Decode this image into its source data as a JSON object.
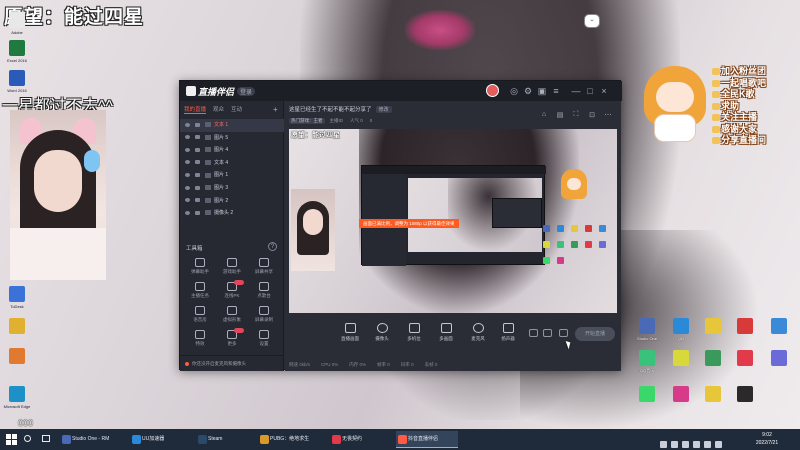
{
  "overlay": {
    "wish": "愿望：能过四星",
    "no_star": "一星都过不去^^",
    "volume_number": "000"
  },
  "desktop": {
    "left_icons": [
      {
        "label": "Adobe",
        "color": "#e8e8e8"
      },
      {
        "label": "Excel 2016",
        "color": "#1f7a3f"
      },
      {
        "label": "Word 2016",
        "color": "#2b5bb8"
      },
      {
        "label": "ToDesk",
        "color": "#3a72d8"
      },
      {
        "label": "",
        "color": "#e0b030"
      },
      {
        "label": "",
        "color": "#e07a30"
      },
      {
        "label": "Microsoft Edge",
        "color": "#1e90c8"
      }
    ],
    "right_icons": [
      {
        "label": "Studio One",
        "color": "#4a6ab8"
      },
      {
        "label": "QQ",
        "color": "#2a8ad8"
      },
      {
        "label": "",
        "color": "#e8c63a"
      },
      {
        "label": "",
        "color": "#d83a3a"
      },
      {
        "label": "",
        "color": "#3a8ad8"
      },
      {
        "label": "",
        "color": "#d8d83a"
      },
      {
        "label": "QQ音乐",
        "color": "#38c27a"
      },
      {
        "label": "",
        "color": "#3a9a5a"
      },
      {
        "label": "",
        "color": "#e23a4a"
      },
      {
        "label": "",
        "color": "#6a6ad8"
      },
      {
        "label": "",
        "color": "#3ad86a"
      },
      {
        "label": "",
        "color": "#d83a8a"
      },
      {
        "label": "",
        "color": "#e8c63a"
      },
      {
        "label": "",
        "color": "#2a2a2a"
      }
    ]
  },
  "commands": [
    "加入粉丝团",
    "一起唱歌吧",
    "全民K歌",
    "求助",
    "关注主播",
    "感谢大家",
    "分享直播间"
  ],
  "app": {
    "name": "直播伴侣",
    "badge": "登录",
    "window_buttons": [
      "—",
      "□",
      "×"
    ],
    "tabs": [
      "我的直播",
      "观众",
      "互动"
    ],
    "layers": [
      "文本 1",
      "图片 5",
      "图片 4",
      "文本 4",
      "图片 1",
      "图片 3",
      "图片 2",
      "摄像头 2"
    ],
    "tools_title": "工具箱",
    "tools": [
      "弹幕助手",
      "游戏助手",
      "屏幕共享",
      "主播任务",
      "连线PK",
      "点歌台",
      "语音房",
      "虚拟形象",
      "屏幕录制",
      "特效",
      "更多",
      "设置"
    ],
    "footer_tip": "你还没开启麦克风和摄像头",
    "stream_title": "这星已经生了不起不能不起分享了",
    "edit_label": "修改",
    "stream_meta": {
      "category": "热门游戏：王者",
      "items": [
        "主播ID",
        "人气 0",
        "0"
      ]
    },
    "preview": {
      "wish_small": "愿望：能过四星",
      "toast": "画面已满比例，调整为 1080p 以获得最佳效果"
    },
    "controls": [
      "直播画面",
      "摄像头",
      "多机位",
      "多画面",
      "麦克风",
      "扬声器"
    ],
    "go_live": "开始直播",
    "status": [
      "网速 0kb/s",
      "CPU 0%",
      "内存 0%",
      "帧率 0",
      "码率 0",
      "丢帧 0"
    ]
  },
  "taskbar": {
    "tasks": [
      {
        "label": "Studio One - RM",
        "color": "#4a6ab8",
        "active": false
      },
      {
        "label": "UU加速器",
        "color": "#2a8ad8",
        "active": false
      },
      {
        "label": "Steam",
        "color": "#2a4a6a",
        "active": false
      },
      {
        "label": "PUBG：绝地求生",
        "color": "#d89a2a",
        "active": false
      },
      {
        "label": "无畏契约",
        "color": "#e23a4a",
        "active": false
      },
      {
        "label": "抖音直播伴侣",
        "color": "#ff5a46",
        "active": true
      }
    ],
    "time": "9:02",
    "date": "2022/7/21"
  }
}
